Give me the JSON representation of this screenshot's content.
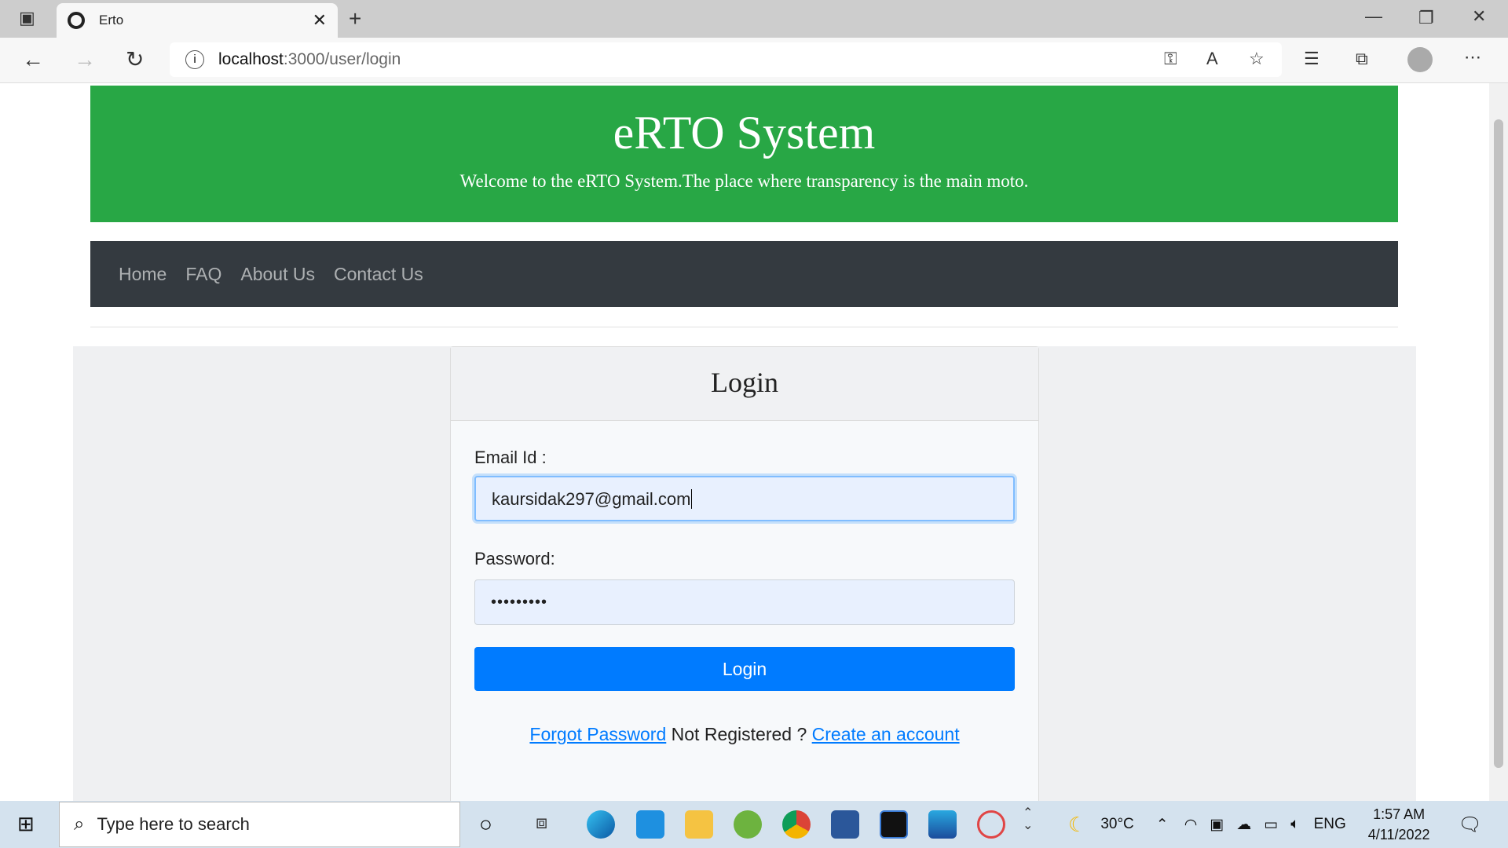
{
  "browser": {
    "tab_title": "Erto",
    "url_host": "localhost",
    "url_path": ":3000/user/login"
  },
  "header": {
    "title": "eRTO System",
    "subtitle": "Welcome to the eRTO System.The place where transparency is the main moto."
  },
  "nav": {
    "items": [
      "Home",
      "FAQ",
      "About Us",
      "Contact Us"
    ]
  },
  "login": {
    "title": "Login",
    "email_label": "Email Id :",
    "email_value": "kaursidak297@gmail.com",
    "password_label": "Password:",
    "password_mask": "•••••••••",
    "button": "Login",
    "forgot": "Forgot Password",
    "not_registered": "Not Registered ?",
    "create": "Create an account"
  },
  "taskbar": {
    "search_placeholder": "Type here to search",
    "temp": "30°C",
    "lang": "ENG",
    "time": "1:57 AM",
    "date": "4/11/2022"
  },
  "colors": {
    "header": "#28a745",
    "nav": "#343a40",
    "button": "#007bff"
  }
}
